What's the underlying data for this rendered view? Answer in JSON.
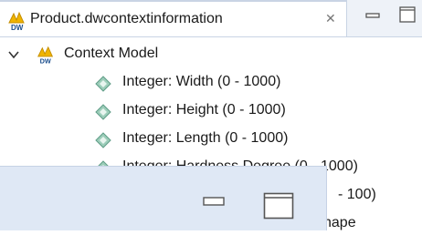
{
  "tab": {
    "title": "Product.dwcontextinformation",
    "close_glyph": "✕",
    "icon": "dw-model-icon"
  },
  "view_controls": {
    "minimize": "minimize-icon",
    "maximize": "maximize-icon"
  },
  "tree": {
    "root": {
      "label": "Context Model",
      "expanded": true,
      "icon": "dw-model-icon"
    },
    "children": [
      {
        "label": "Integer: Width (0 - 1000)"
      },
      {
        "label": "Integer: Height (0 - 1000)"
      },
      {
        "label": "Integer: Length (0 - 1000)"
      },
      {
        "label": "Integer: Hardness Degree (0 - 1000)"
      },
      {
        "label": "- 100)"
      },
      {
        "label": "hape"
      }
    ]
  },
  "colors": {
    "accent_yellow": "#f0b400",
    "leaf_icon": "#7fb8a3",
    "overlay_bg": "#dfe8f5"
  }
}
